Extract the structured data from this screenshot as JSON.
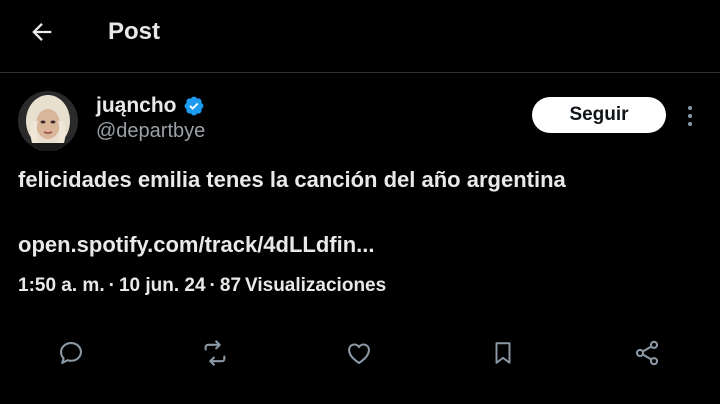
{
  "header": {
    "title": "Post",
    "back_icon": "arrow-left-icon"
  },
  "author": {
    "display_name": "juąncho",
    "verified": true,
    "handle": "@departbye",
    "follow_label": "Seguir"
  },
  "post": {
    "text": "felicidades emilia tenes la canción del año argentina",
    "link": "open.spotify.com/track/4dLLdfin...",
    "time": "1:50 a. m.",
    "date": "10 jun. 24",
    "views": "87",
    "views_label": "Visualizaciones"
  },
  "actions": [
    "reply-icon",
    "repost-icon",
    "like-icon",
    "bookmark-icon",
    "share-icon"
  ],
  "colors": {
    "background": "#000000",
    "text": "#e7e9ea",
    "muted": "#9aa0a6",
    "verified": "#1d9bf0",
    "divider": "#2f3336"
  }
}
